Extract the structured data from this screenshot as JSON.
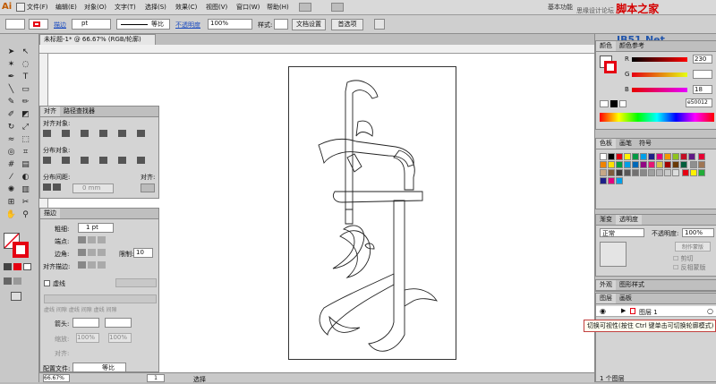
{
  "app": {
    "logo": "Ai"
  },
  "menu": [
    "文件(F)",
    "编辑(E)",
    "对象(O)",
    "文字(T)",
    "选择(S)",
    "效果(C)",
    "视图(V)",
    "窗口(W)",
    "帮助(H)"
  ],
  "workspace": "基本功能",
  "watermark": {
    "forum": "思缘设计论坛 ",
    "site_cn": "脚本之家",
    "site_en": "JB51.Net"
  },
  "control": {
    "stroke_label": "描边",
    "stroke_value": "pt",
    "stroke_profile": "等比",
    "opacity_label": "不透明度",
    "opacity_value": "100%",
    "style_label": "样式:",
    "doc_setup": "文档设置",
    "prefs": "首选项"
  },
  "document": {
    "tab_title": "未标题-1* @ 66.67% (RGB/轮廓)"
  },
  "align_panel": {
    "tabs": [
      "对齐",
      "路径查找器"
    ],
    "align_objects": "对齐对象:",
    "distribute_objects": "分布对象:",
    "distribute_spacing": "分布间距:",
    "spacing_value": "0 mm",
    "align_to": "对齐:"
  },
  "stroke_panel": {
    "tab": "描边",
    "weight_label": "粗细:",
    "weight_value": "1 pt",
    "cap_label": "端点:",
    "corner_label": "边角:",
    "limit_label": "限制:",
    "limit_value": "10",
    "align_label": "对齐描边:",
    "dashed_label": "虚线",
    "arrow_label": "箭头:",
    "scale_label": "缩放:",
    "scale1": "100%",
    "scale2": "100%",
    "align_arrow": "对齐:",
    "profile_label": "配置文件:",
    "profile_value": "等比"
  },
  "color_panel": {
    "tabs": [
      "颜色",
      "颜色参考"
    ],
    "r_label": "R",
    "g_label": "G",
    "b_label": "B",
    "r_value": "230",
    "g_value": "",
    "b_value": "18",
    "hex_value": "e50012"
  },
  "swatches_panel": {
    "tabs": [
      "色板",
      "画笔",
      "符号"
    ]
  },
  "transparency_panel": {
    "tabs": [
      "渐变",
      "透明度"
    ],
    "mode": "正常",
    "opacity_label": "不透明度:",
    "opacity_value": "100%",
    "make_mask": "制作蒙版",
    "clip": "剪切",
    "invert": "反相蒙版"
  },
  "appearance_tabs": [
    "外观",
    "图形样式"
  ],
  "layers_panel": {
    "tabs": [
      "图层",
      "画板"
    ],
    "layer_name": "图层 1",
    "count": "1 个图层"
  },
  "tooltip": "切换可视性(按住 Ctrl 键单击可切换轮廓模式)",
  "status": {
    "zoom": "66.67%",
    "page": "1",
    "tool": "选择"
  },
  "colors": {
    "accent": "#e50012",
    "panel": "#d4d4d4"
  }
}
